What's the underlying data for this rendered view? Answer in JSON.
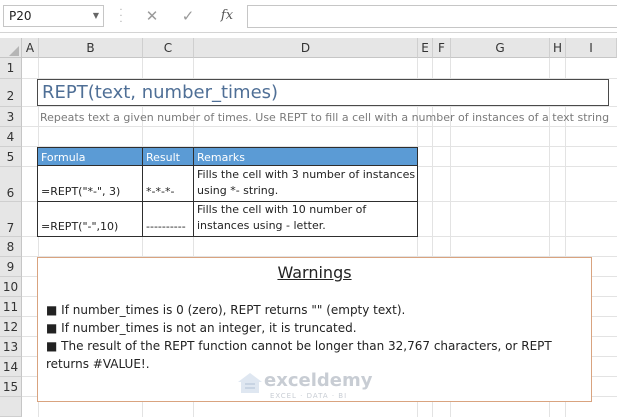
{
  "formula_bar": {
    "name_box": "P20",
    "cancel_icon": "close-icon",
    "enter_icon": "check-icon",
    "fx_label": "fx",
    "formula": ""
  },
  "columns": [
    "A",
    "B",
    "C",
    "D",
    "E",
    "F",
    "G",
    "H",
    "I"
  ],
  "rows": [
    "1",
    "2",
    "3",
    "4",
    "5",
    "6",
    "7",
    "8",
    "9",
    "10",
    "11",
    "12",
    "13",
    "14",
    "15"
  ],
  "sheet": {
    "title": "REPT(text, number_times)",
    "description": "Repeats text a given number of times. Use REPT to fill a cell with a number of instances of a text string",
    "table": {
      "headers": [
        "Formula",
        "Result",
        "Remarks"
      ],
      "rows": [
        {
          "formula": "=REPT(\"*-\", 3)",
          "result": "*-*-*-",
          "remarks_1": "Fills the cell with 3 number of instances",
          "remarks_2": "using *- string."
        },
        {
          "formula": "=REPT(\"-\",10)",
          "result": "----------",
          "remarks_1": "Fills the cell with 10 number of",
          "remarks_2": "instances using - letter."
        }
      ]
    },
    "warnings": {
      "title": "Warnings",
      "items": [
        "■ If number_times is 0 (zero), REPT returns \"\" (empty text).",
        "■ If number_times is not an integer, it is truncated.",
        "■ The result of the REPT function cannot be longer than 32,767 characters, or REPT",
        "returns #VALUE!."
      ]
    }
  },
  "watermark": {
    "name": "exceldemy",
    "tagline": "EXCEL · DATA · BI"
  },
  "colors": {
    "header_blue": "#5b9bd5",
    "title_text": "#4f6f96",
    "warning_border": "#d9a37f"
  }
}
